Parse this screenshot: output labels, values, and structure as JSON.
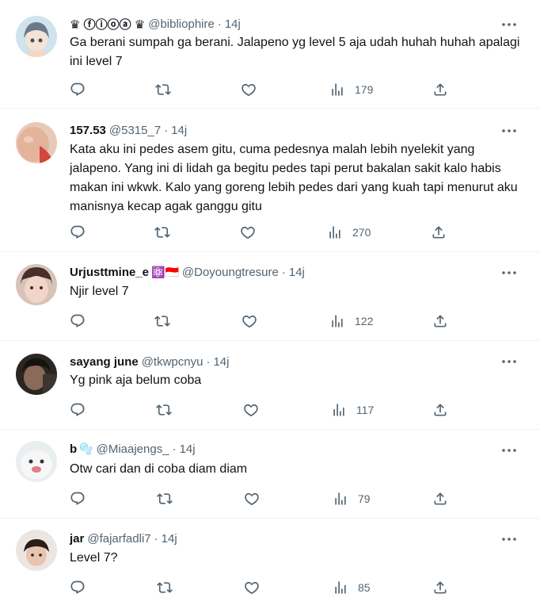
{
  "tweets": [
    {
      "name": "♛ ⓕⓘⓞⓐ ♛",
      "badge": "",
      "handle": "@bibliophire",
      "time": "14j",
      "text": "Ga berani sumpah ga berani. Jalapeno yg level 5 aja udah huhah huhah apalagi ini level 7",
      "views": "179"
    },
    {
      "name": "157.53",
      "badge": "",
      "handle": "@5315_7",
      "time": "14j",
      "text": "Kata aku ini pedes asem gitu, cuma pedesnya malah lebih nyelekit yang jalapeno. Yang ini di lidah ga begitu pedes tapi perut bakalan sakit kalo habis makan ini wkwk. Kalo yang goreng lebih pedes dari yang kuah tapi menurut aku manisnya kecap agak ganggu gitu",
      "views": "270"
    },
    {
      "name": "Urjusttmine_e",
      "badge": "⚛️🇮🇩",
      "handle": "@Doyoungtresure",
      "time": "14j",
      "text": "Njir level 7",
      "views": "122"
    },
    {
      "name": "sayang june",
      "badge": "",
      "handle": "@tkwpcnyu",
      "time": "14j",
      "text": "Yg pink aja belum coba",
      "views": "117"
    },
    {
      "name": "b",
      "badge": "🫧",
      "handle": "@Miaajengs_",
      "time": "14j",
      "text": "Otw cari dan di coba diam diam",
      "views": "79"
    },
    {
      "name": "jar",
      "badge": "",
      "handle": "@fajarfadli7",
      "time": "14j",
      "text": "Level 7?",
      "views": "85"
    }
  ],
  "icons": {
    "reply": "reply-icon",
    "retweet": "retweet-icon",
    "like": "like-icon",
    "views": "views-icon",
    "share": "share-icon",
    "more": "more-icon"
  },
  "colors": {
    "text": "#0f1419",
    "secondary": "#536471",
    "divider": "#eff3f4"
  }
}
